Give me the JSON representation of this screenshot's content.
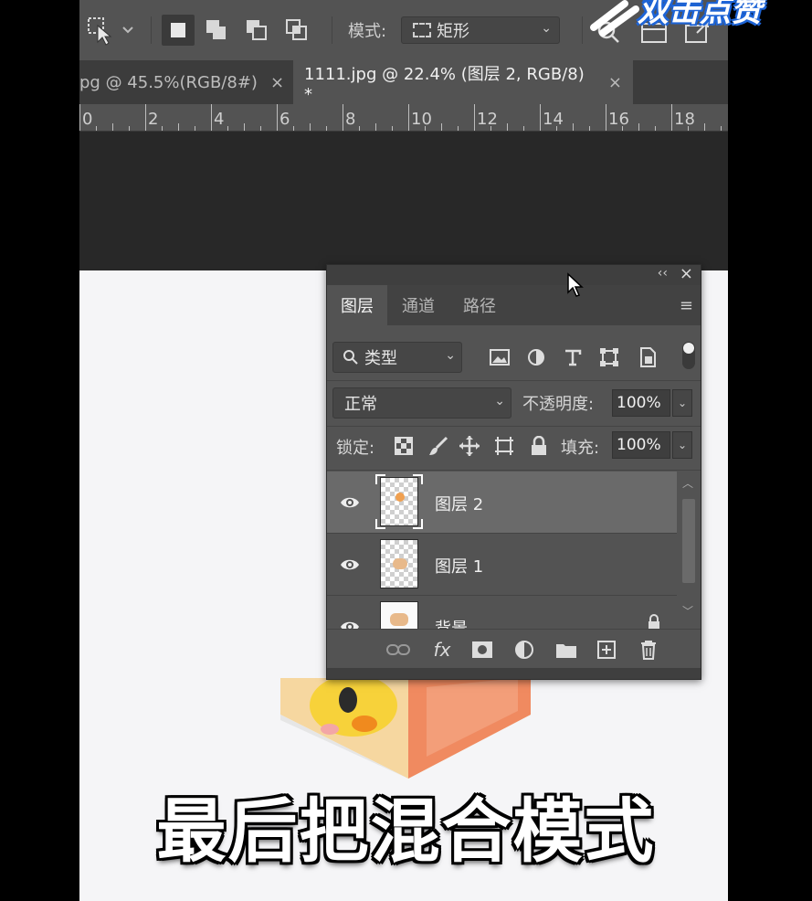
{
  "options_bar": {
    "mode_label": "模式:",
    "mode_value": "矩形"
  },
  "tabs": [
    {
      "label": "pg @ 45.5%(RGB/8#)",
      "close": "×"
    },
    {
      "label": "1111.jpg @ 22.4% (图层 2, RGB/8) *",
      "close": "×"
    }
  ],
  "ruler": {
    "labels": [
      "0",
      "2",
      "4",
      "6",
      "8",
      "10",
      "12",
      "14",
      "16",
      "18"
    ]
  },
  "layers_panel": {
    "collapse": "‹‹",
    "close": "×",
    "menu": "≡",
    "tabs": [
      "图层",
      "通道",
      "路径"
    ],
    "filter_value": "类型",
    "blend_mode": "正常",
    "opacity_label": "不透明度:",
    "opacity_value": "100%",
    "lock_label": "锁定:",
    "fill_label": "填充:",
    "fill_value": "100%",
    "layers": [
      {
        "name": "图层 2",
        "selected": true
      },
      {
        "name": "图层 1",
        "selected": false
      },
      {
        "name": "背景",
        "selected": false
      }
    ],
    "footer_fx": "fx"
  },
  "subtitle": "最后把混合模式",
  "corner_text": "双击点赞",
  "colors": {
    "panel_bg": "#535353",
    "canvas_dark": "#282828",
    "doc_bg": "#f5f5f7",
    "selected_layer": "#6a6a6a"
  }
}
